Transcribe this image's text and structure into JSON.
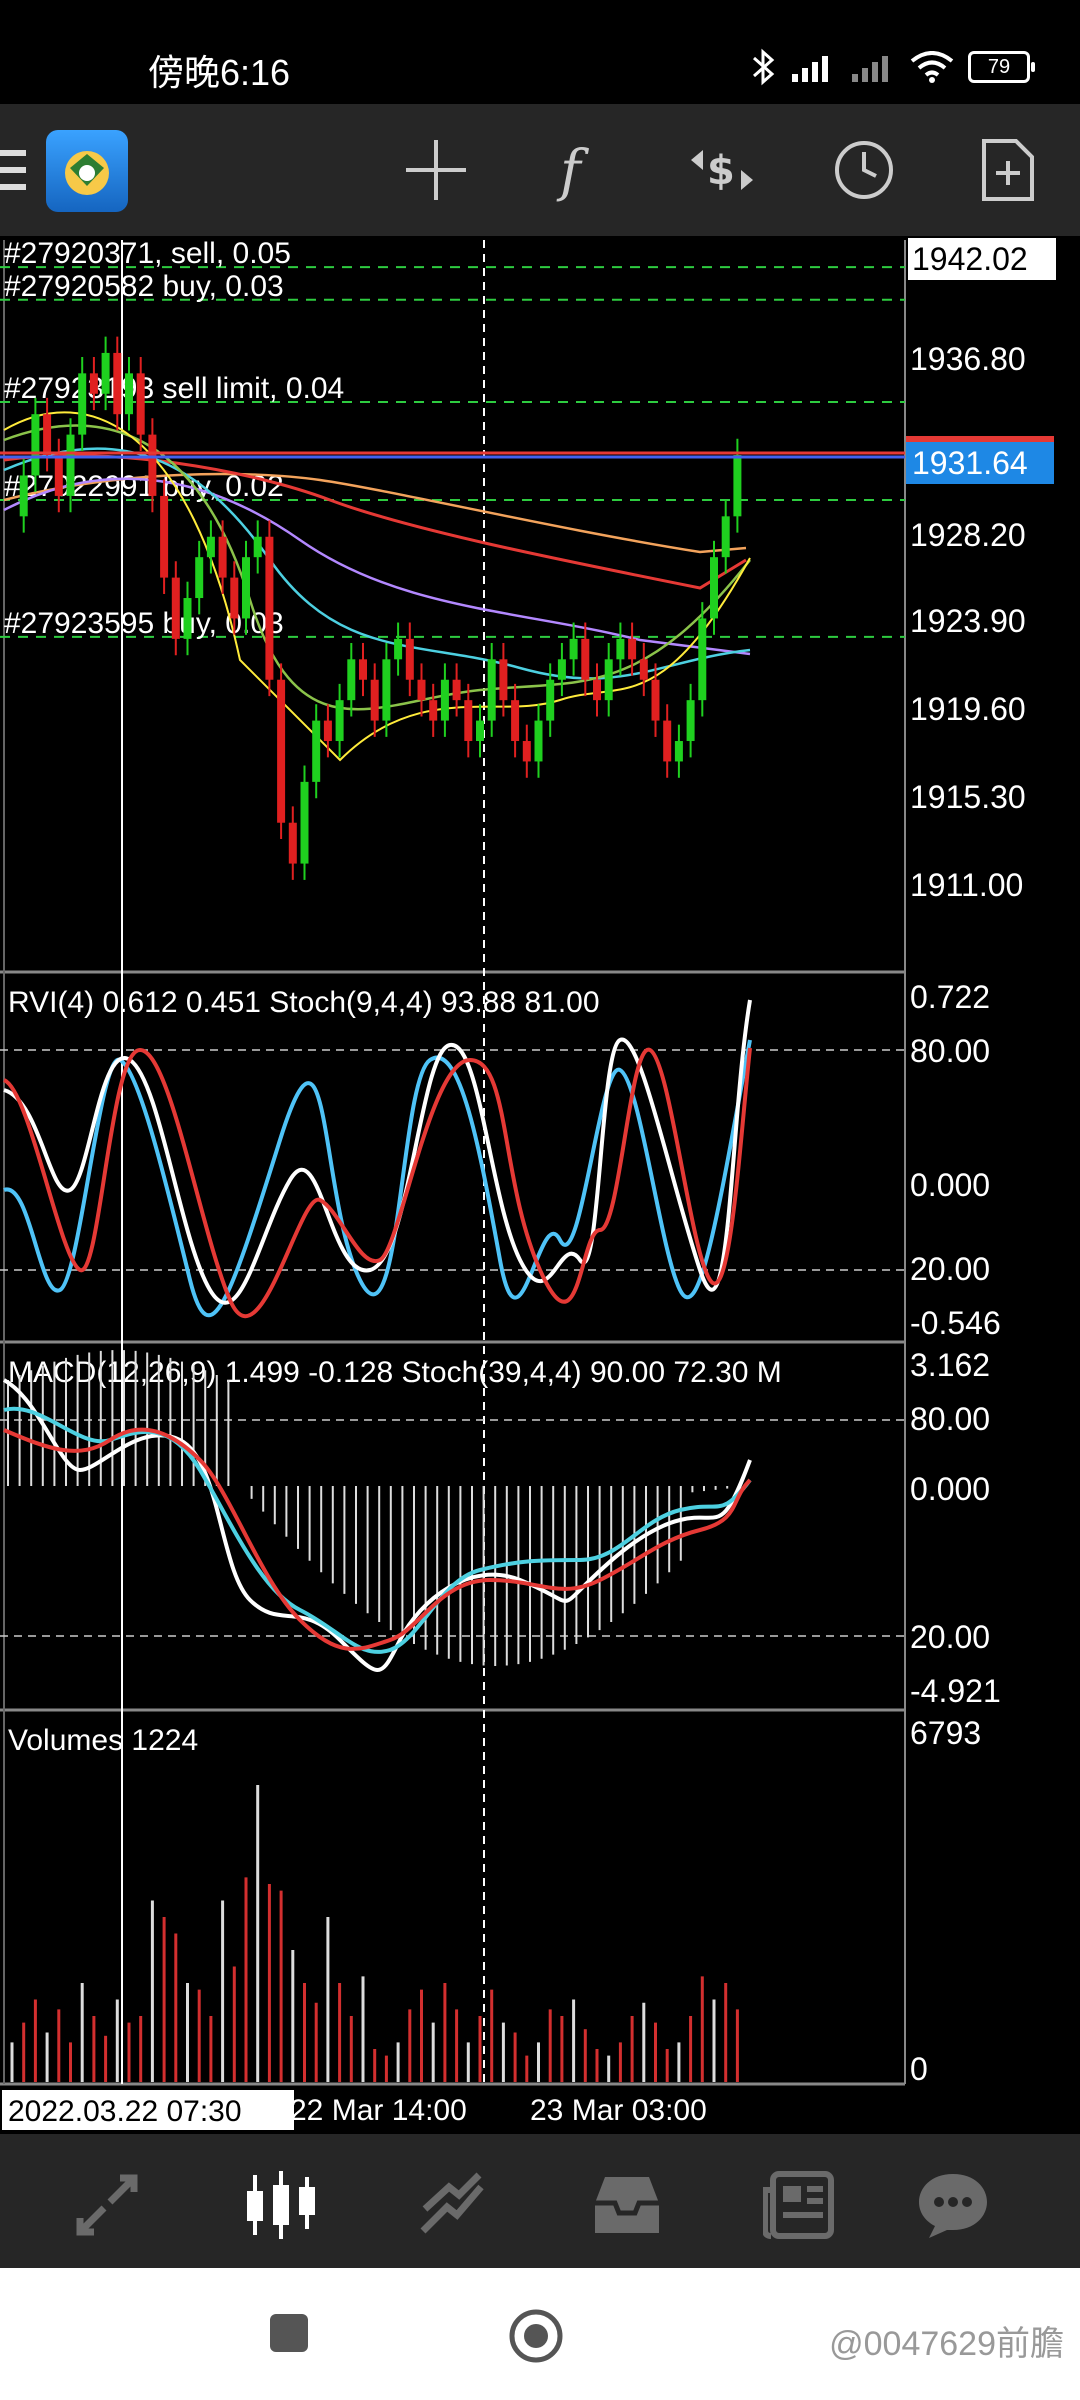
{
  "status_bar": {
    "time": "傍晚6:16",
    "battery": "79"
  },
  "toolbar": {
    "icons": [
      "menu-icon",
      "app-logo",
      "crosshair-icon",
      "indicators-icon",
      "trade-icon",
      "period-icon",
      "add-object-icon"
    ]
  },
  "main_chart": {
    "price_current": "1931.64",
    "price_top": "1942.02",
    "price_scale": [
      "1936.80",
      "1928.20",
      "1923.90",
      "1919.60",
      "1915.30",
      "1911.00"
    ],
    "orders": [
      {
        "label": "#27920371, sell, 0.05",
        "price": 1941.2
      },
      {
        "label": "#27920582 buy, 0.03",
        "price": 1939.6
      },
      {
        "label": "#27923193 sell limit, 0.04",
        "price": 1934.6
      },
      {
        "label": "#27922991 buy, 0.02",
        "price": 1929.8
      },
      {
        "label": "#27923595 buy, 0.03",
        "price": 1923.1
      }
    ]
  },
  "rvi_panel": {
    "label": "RVI(4) 0.612 0.451 Stoch(9,4,4) 93.88 81.00",
    "scale": [
      "0.722",
      "80.00",
      "0.000",
      "20.00",
      "-0.546"
    ]
  },
  "macd_panel": {
    "label": "MACD(12,26,9) 1.499 -0.128 Stoch(39,4,4) 90.00 72.30 M",
    "scale": [
      "3.162",
      "80.00",
      "0.000",
      "20.00",
      "-4.921"
    ]
  },
  "volume_panel": {
    "label": "Volumes 1224",
    "scale": [
      "6793",
      "0"
    ]
  },
  "time_axis": {
    "cursor_label": "2022.03.22 07:30",
    "labels": [
      "22 Mar 14:00",
      "23 Mar 03:00"
    ]
  },
  "colors": {
    "bull": "#1fd01f",
    "bear": "#e02020",
    "price_tag": "#1e88e5",
    "grid": "#2ecc40"
  },
  "bottom_nav": {
    "items": [
      "quotes-icon",
      "chart-icon",
      "trade-icon",
      "history-icon",
      "news-icon",
      "messages-icon"
    ],
    "active": 1
  },
  "watermark": "@0047629前膽"
}
